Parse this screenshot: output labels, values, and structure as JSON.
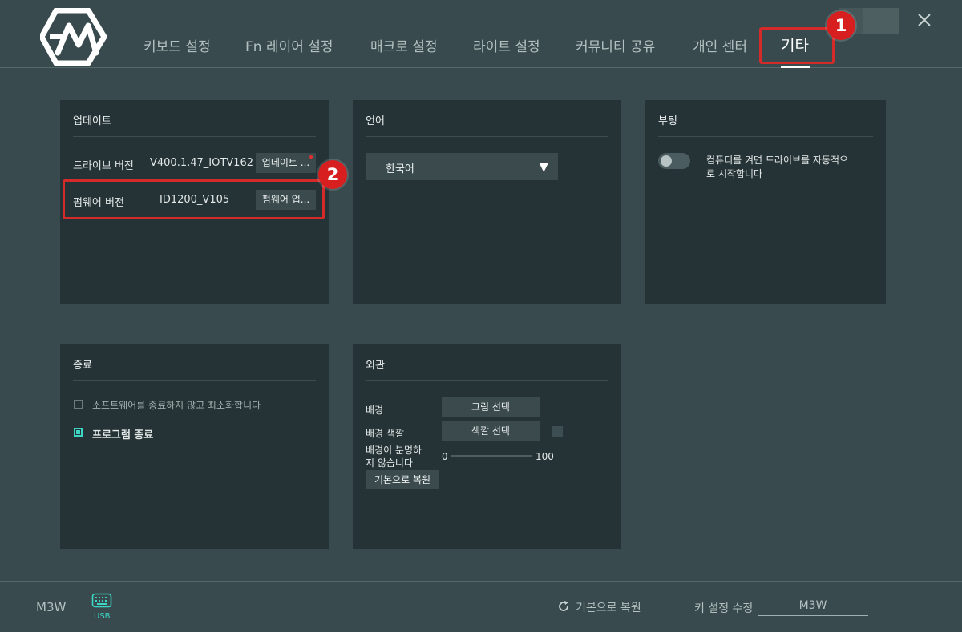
{
  "nav": {
    "tabs": [
      {
        "label": "키보드 설정"
      },
      {
        "label": "Fn 레이어 설정"
      },
      {
        "label": "매크로 설정"
      },
      {
        "label": "라이트 설정"
      },
      {
        "label": "커뮤니티 공유"
      },
      {
        "label": "개인 센터"
      },
      {
        "label": "기타"
      }
    ],
    "active_tab": "기타"
  },
  "annotations": {
    "badge1": "1",
    "badge2": "2",
    "color": "#d42a2a"
  },
  "update_panel": {
    "title": "업데이트",
    "driver_label": "드라이브 버전",
    "driver_version": "V400.1.47_IOTV162",
    "driver_button": "업데이트 ...",
    "firmware_label": "펌웨어 버전",
    "firmware_version": "ID1200_V105",
    "firmware_button": "펌웨어 업..."
  },
  "language_panel": {
    "title": "언어",
    "selected": "한국어",
    "arrow": "▼"
  },
  "boot_panel": {
    "title": "부팅",
    "toggle_on": false,
    "description_line1": "컴퓨터를 켜면 드라이브를 자동적으",
    "description_line2": "로 시작합니다"
  },
  "exit_panel": {
    "title": "종료",
    "option_minimize": "소프트웨어를 종료하지 않고 최소화합니다",
    "option_minimize_checked": false,
    "option_exit": "프로그램 종료",
    "option_exit_checked": true
  },
  "appearance_panel": {
    "title": "외관",
    "bg_label": "배경",
    "bg_button": "그림 선택",
    "bg_color_label": "배경 색깔",
    "bg_color_button": "색깔 선택",
    "opacity_label_line1": "배경이 분명하",
    "opacity_label_line2": "지 않습니다",
    "opacity_min": "0",
    "opacity_max": "100",
    "opacity_value": 0,
    "reset_button": "기본으로 복원"
  },
  "footer": {
    "device_name": "M3W",
    "connection": "USB",
    "reset_label": "기본으로 복원",
    "key_setting_label": "키 설정 수정",
    "key_setting_value": "M3W"
  },
  "colors": {
    "background": "#384a4d",
    "panel": "#263336",
    "accent": "#3dd6c4",
    "annotation_red": "#d42a2a"
  },
  "icons": [
    "app-logo-icon",
    "close-icon",
    "refresh-icon",
    "keyboard-icon",
    "dropdown-arrow-icon"
  ]
}
